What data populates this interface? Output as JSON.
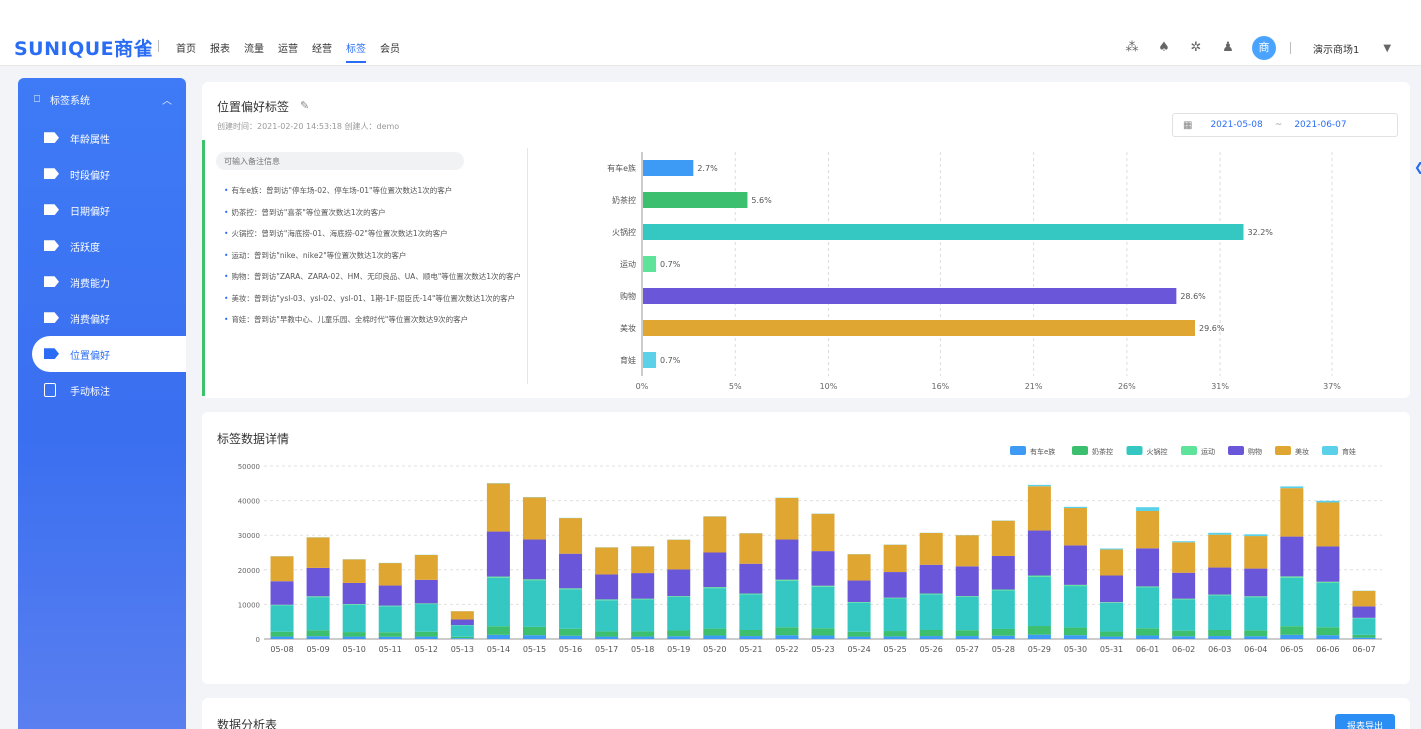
{
  "brand": {
    "logo": "SUNIQUE商雀"
  },
  "nav": [
    "首页",
    "报表",
    "流量",
    "运营",
    "经营",
    "标签",
    "会员"
  ],
  "nav_active_index": 5,
  "topbar": {
    "store": "演示商场1",
    "avatar_glyph": "商"
  },
  "sidebar": {
    "header": "标签系统",
    "items": [
      {
        "label": "年龄属性",
        "icon": "tag-icon"
      },
      {
        "label": "时段偏好",
        "icon": "tag-icon"
      },
      {
        "label": "日期偏好",
        "icon": "tag-icon"
      },
      {
        "label": "活跃度",
        "icon": "tag-icon"
      },
      {
        "label": "消费能力",
        "icon": "tag-icon"
      },
      {
        "label": "消费偏好",
        "icon": "tag-icon"
      },
      {
        "label": "位置偏好",
        "icon": "tag-icon"
      },
      {
        "label": "手动标注",
        "icon": "document-icon"
      }
    ],
    "active_index": 6
  },
  "tag_card": {
    "title": "位置偏好标签",
    "meta": "创建时间：2021-02-20 14:53:18   创建人：demo",
    "date_start": "2021-05-08",
    "date_end": "2021-06-07",
    "date_sep": "~",
    "note_placeholder": "可输入备注信息",
    "notes": [
      "有车e族：曾到访\"停车场-02、停车场-01\"等位置次数达1次的客户",
      "奶茶控：曾到访\"喜茶\"等位置次数达1次的客户",
      "火锅控：曾到访\"海底捞-01、海底捞-02\"等位置次数达1次的客户",
      "运动：曾到访\"nike、nike2\"等位置次数达1次的客户",
      "购物：曾到访\"ZARA、ZARA-02、HM、无印良品、UA、顺电\"等位置次数达1次的客户",
      "美妆：曾到访\"ysl-03、ysl-02、ysl-01、1期-1F-屈臣氏-14\"等位置次数达1次的客户",
      "育娃：曾到访\"早教中心、儿童乐园、全棉时代\"等位置次数达9次的客户"
    ]
  },
  "chart_data": [
    {
      "type": "bar",
      "orientation": "horizontal",
      "categories": [
        "有车e族",
        "奶茶控",
        "火锅控",
        "运动",
        "购物",
        "美妆",
        "育娃"
      ],
      "values": [
        2.7,
        5.6,
        32.2,
        0.7,
        28.6,
        29.6,
        0.7
      ],
      "value_labels": [
        "2.7%",
        "5.6%",
        "32.2%",
        "0.7%",
        "28.6%",
        "29.6%",
        "0.7%"
      ],
      "colors": [
        "#3d9bf5",
        "#3cbf6e",
        "#35c8c2",
        "#5ee39a",
        "#6a56d9",
        "#e0a632",
        "#5ad1e8"
      ],
      "xlim": [
        0,
        37
      ],
      "xticks": [
        "0%",
        "5%",
        "10%",
        "16%",
        "21%",
        "26%",
        "31%",
        "37%"
      ],
      "grid": true
    },
    {
      "type": "bar",
      "stacked": true,
      "title": "标签数据详情",
      "categories": [
        "05-08",
        "05-09",
        "05-10",
        "05-11",
        "05-12",
        "05-13",
        "05-14",
        "05-15",
        "05-16",
        "05-17",
        "05-18",
        "05-19",
        "05-20",
        "05-21",
        "05-22",
        "05-23",
        "05-24",
        "05-25",
        "05-26",
        "05-27",
        "05-28",
        "05-29",
        "05-30",
        "05-31",
        "06-01",
        "06-02",
        "06-03",
        "06-04",
        "06-05",
        "06-06",
        "06-07"
      ],
      "ylim": [
        0,
        50000
      ],
      "yticks": [
        "0",
        "10000",
        "20000",
        "30000",
        "40000",
        "50000"
      ],
      "legend_position": "top-right",
      "grid": true,
      "series": [
        {
          "name": "有车e族",
          "color": "#3d9bf5",
          "values": [
            700,
            800,
            700,
            650,
            700,
            250,
            1200,
            1100,
            950,
            700,
            700,
            800,
            1000,
            850,
            1100,
            1000,
            700,
            750,
            850,
            850,
            950,
            1250,
            1100,
            700,
            1000,
            800,
            850,
            800,
            1200,
            1100,
            400
          ]
        },
        {
          "name": "奶茶控",
          "color": "#3cbf6e",
          "values": [
            1400,
            1700,
            1300,
            1300,
            1400,
            400,
            2500,
            2400,
            2000,
            1500,
            1500,
            1650,
            2000,
            1750,
            2300,
            2100,
            1400,
            1550,
            1750,
            1700,
            1950,
            2500,
            2200,
            1450,
            2100,
            1600,
            1750,
            1700,
            2500,
            2300,
            800
          ]
        },
        {
          "name": "火锅控",
          "color": "#35c8c2",
          "values": [
            7600,
            9600,
            7900,
            7500,
            8000,
            3300,
            14000,
            13400,
            11400,
            9000,
            9200,
            9700,
            11700,
            10300,
            13400,
            12000,
            8400,
            9400,
            10300,
            9600,
            11100,
            14200,
            12000,
            8300,
            11800,
            9000,
            10000,
            9600,
            14000,
            12800,
            4800
          ]
        },
        {
          "name": "运动",
          "color": "#5ee39a",
          "values": [
            200,
            250,
            200,
            200,
            200,
            80,
            350,
            350,
            300,
            250,
            250,
            250,
            300,
            250,
            350,
            300,
            200,
            250,
            250,
            250,
            300,
            400,
            350,
            200,
            300,
            250,
            250,
            250,
            400,
            350,
            120
          ]
        },
        {
          "name": "购物",
          "color": "#6a56d9",
          "values": [
            6800,
            8200,
            6100,
            5800,
            6800,
            1600,
            13000,
            11500,
            10000,
            7200,
            7400,
            7700,
            10000,
            8600,
            11600,
            10000,
            6200,
            7400,
            8300,
            8600,
            9700,
            13000,
            11400,
            7700,
            11000,
            7500,
            7800,
            8000,
            11500,
            10200,
            3300
          ]
        },
        {
          "name": "美妆",
          "color": "#e0a632",
          "values": [
            7200,
            8800,
            6800,
            6500,
            7200,
            2400,
            13900,
            12200,
            10300,
            7800,
            7700,
            8600,
            10400,
            8800,
            12000,
            10800,
            7600,
            7900,
            9200,
            9000,
            10200,
            12800,
            10800,
            7500,
            10800,
            8800,
            9500,
            9400,
            14000,
            12700,
            4500
          ]
        },
        {
          "name": "育娃",
          "color": "#5ad1e8",
          "values": [
            50,
            50,
            50,
            50,
            50,
            20,
            80,
            80,
            60,
            50,
            50,
            50,
            60,
            50,
            80,
            70,
            40,
            50,
            50,
            50,
            60,
            400,
            350,
            300,
            1100,
            300,
            550,
            500,
            500,
            500,
            60
          ]
        }
      ]
    }
  ],
  "analysis_card": {
    "title": "数据分析表",
    "export_label": "报表导出"
  }
}
